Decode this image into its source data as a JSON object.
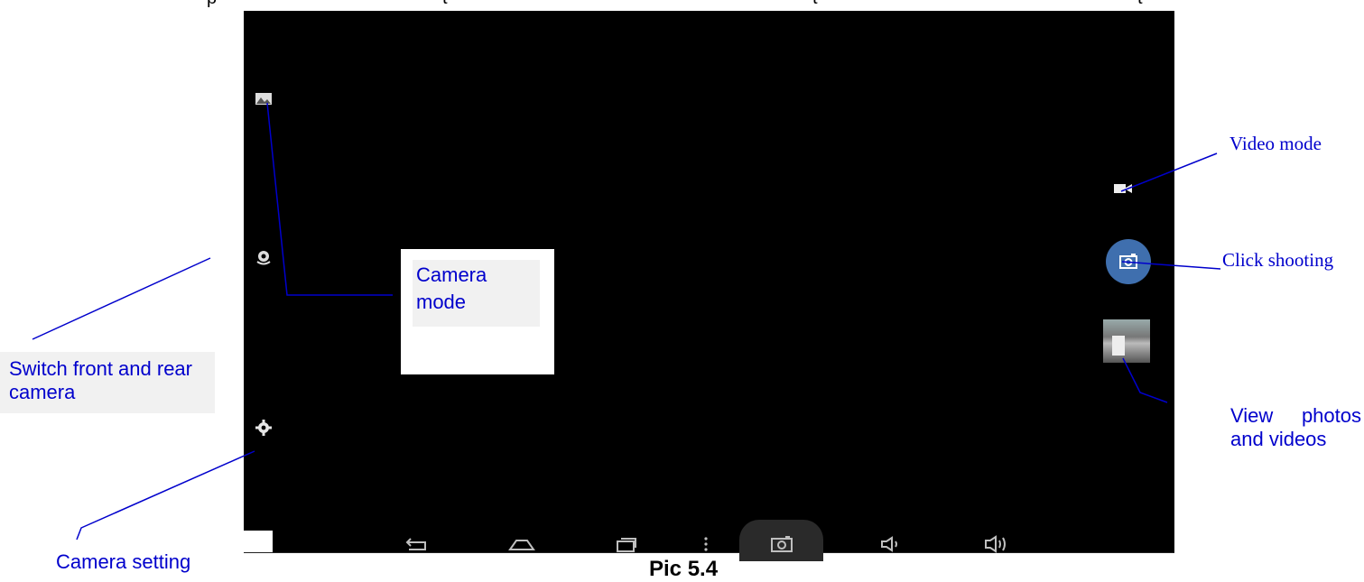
{
  "header_text": "p t t t",
  "annotations": {
    "camera_mode": "Camera\nmode",
    "switch_camera": "Switch front and rear camera",
    "camera_setting": "Camera setting",
    "video_mode": "Video mode",
    "click_shooting": "Click shooting",
    "view_photos": "View photos and videos"
  },
  "caption": "Pic 5.4",
  "icons": {
    "camera_mode": "panorama-icon",
    "switch": "switch-camera-icon",
    "settings": "gear-icon",
    "video": "video-camera-icon",
    "shutter": "camera-shutter-icon",
    "thumbnail": "gallery-thumbnail",
    "nav_back": "back-icon",
    "nav_home": "home-icon",
    "nav_recent": "recent-apps-icon",
    "nav_menu": "menu-dots-icon",
    "nav_camera": "camera-icon",
    "vol_down": "volume-down-icon",
    "vol_up": "volume-up-icon"
  },
  "colors": {
    "annotation": "#0000cc",
    "screen": "#000000",
    "shutter": "#3f6fae"
  }
}
